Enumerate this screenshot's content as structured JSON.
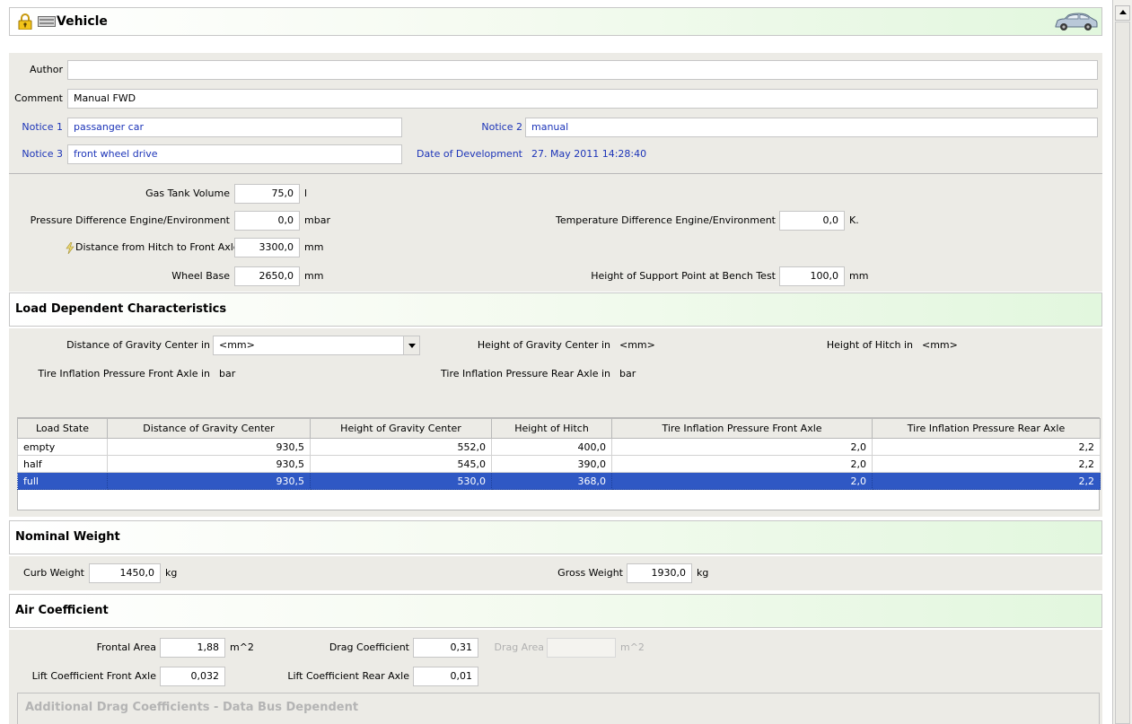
{
  "title": "Vehicle",
  "meta": {
    "author_label": "Author",
    "author_value": "",
    "comment_label": "Comment",
    "comment_value": "Manual FWD",
    "notice1_label": "Notice 1",
    "notice1_value": "passanger car",
    "notice2_label": "Notice 2",
    "notice2_value": "manual",
    "notice3_label": "Notice 3",
    "notice3_value": "front wheel drive",
    "date_label": "Date of Development",
    "date_value": "27. May 2011 14:28:40"
  },
  "params": {
    "gas_tank_label": "Gas Tank Volume",
    "gas_tank_value": "75,0",
    "gas_tank_unit": "l",
    "pressure_label": "Pressure Difference Engine/Environment",
    "pressure_value": "0,0",
    "pressure_unit": "mbar",
    "temp_label": "Temperature Difference Engine/Environment",
    "temp_value": "0,0",
    "temp_unit": "K.",
    "hitch_label": "Distance from Hitch to Front Axle",
    "hitch_value": "3300,0",
    "hitch_unit": "mm",
    "wheelbase_label": "Wheel Base",
    "wheelbase_value": "2650,0",
    "wheelbase_unit": "mm",
    "support_label": "Height of Support Point at Bench Test",
    "support_value": "100,0",
    "support_unit": "mm"
  },
  "load": {
    "header": "Load Dependent Characteristics",
    "dist_cg_label": "Distance of Gravity Center in",
    "dist_cg_unit": "<mm>",
    "height_cg_label": "Height of Gravity Center in",
    "height_cg_unit": "<mm>",
    "height_hitch_label": "Height of Hitch in",
    "height_hitch_unit": "<mm>",
    "tire_front_label": "Tire Inflation Pressure Front Axle in",
    "tire_front_unit": "bar",
    "tire_rear_label": "Tire Inflation Pressure Rear Axle in",
    "tire_rear_unit": "bar",
    "columns": [
      "Load State",
      "Distance of Gravity Center",
      "Height of Gravity Center",
      "Height of Hitch",
      "Tire Inflation Pressure Front Axle",
      "Tire Inflation Pressure Rear Axle"
    ],
    "rows": [
      [
        "empty",
        "930,5",
        "552,0",
        "400,0",
        "2,0",
        "2,2"
      ],
      [
        "half",
        "930,5",
        "545,0",
        "390,0",
        "2,0",
        "2,2"
      ],
      [
        "full",
        "930,5",
        "530,0",
        "368,0",
        "2,0",
        "2,2"
      ]
    ],
    "selected_row": "full"
  },
  "weight": {
    "header": "Nominal Weight",
    "curb_label": "Curb Weight",
    "curb_value": "1450,0",
    "curb_unit": "kg",
    "gross_label": "Gross Weight",
    "gross_value": "1930,0",
    "gross_unit": "kg"
  },
  "air": {
    "header": "Air Coefficient",
    "frontal_label": "Frontal Area",
    "frontal_value": "1,88",
    "frontal_unit": "m^2",
    "drag_label": "Drag Coefficient",
    "drag_value": "0,31",
    "drag_area_label": "Drag Area",
    "drag_area_value": "",
    "drag_area_unit": "m^2",
    "lift_front_label": "Lift Coefficient Front Axle",
    "lift_front_value": "0,032",
    "lift_rear_label": "Lift Coefficient Rear Axle",
    "lift_rear_value": "0,01",
    "additional_header": "Additional Drag Coefficients - Data Bus Dependent"
  },
  "icons": [
    "lock-icon",
    "keyboard-icon",
    "car-icon",
    "scroll-up-icon",
    "lightning-icon",
    "dropdown-arrow-icon"
  ],
  "colors": {
    "label_blue": "#1c34b8",
    "selection": "#2f58c4",
    "header_green": "#e2f7de",
    "panel_gray": "#ecebe6"
  }
}
